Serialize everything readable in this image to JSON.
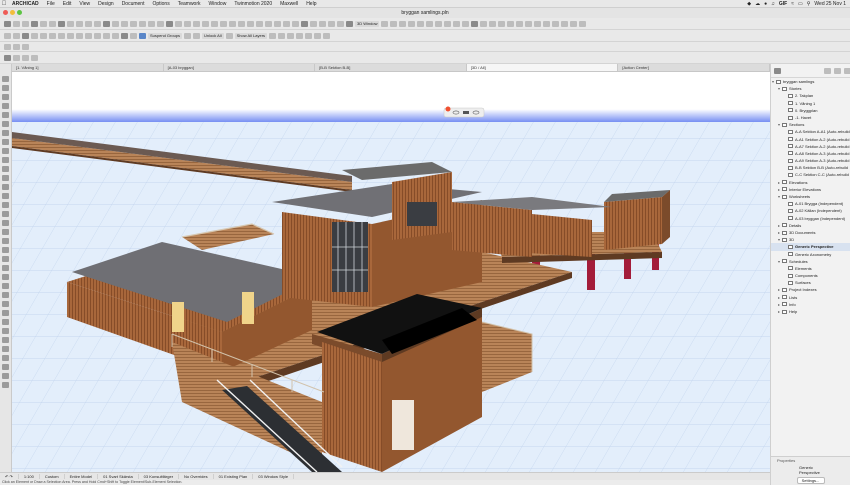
{
  "menubar": {
    "app": "ARCHICAD",
    "items": [
      "File",
      "Edit",
      "View",
      "Design",
      "Document",
      "Options",
      "Teamwork",
      "Window",
      "Twinmotion 2020",
      "Maxwell",
      "Help"
    ],
    "gif": "GIF",
    "clock": "Wed 25 Nov 1"
  },
  "window": {
    "title": "bryggan samlings.pln"
  },
  "toolbar": {
    "window_3d": "3D Window",
    "suspend_groups": "Suspend Groups",
    "unlock_all": "Unlock All",
    "show_all_layers": "Show All Layers"
  },
  "tabs": [
    {
      "label": "[1. Våning 1]"
    },
    {
      "label": "[A-03 bryggan]"
    },
    {
      "label": "[B-B Sektion B-B]"
    },
    {
      "label": "[3D / All]"
    },
    {
      "label": "[Action Center]"
    }
  ],
  "navigator": {
    "items": [
      {
        "label": "bryggan samlings",
        "level": 0,
        "open": true
      },
      {
        "label": "Stories",
        "level": 1,
        "open": true
      },
      {
        "label": "2. Takplan",
        "level": 2
      },
      {
        "label": "1. Våning 1",
        "level": 2
      },
      {
        "label": "0. Bryggplan",
        "level": 2
      },
      {
        "label": "-1. Havet",
        "level": 2
      },
      {
        "label": "Sections",
        "level": 1,
        "open": true
      },
      {
        "label": "A-A Sektion A-A1 (Auto-rebuild",
        "level": 2
      },
      {
        "label": "A-A1 Sektion A-2 (Auto-rebuild",
        "level": 2
      },
      {
        "label": "A-A7 Sektion A-2 (Auto-rebuild",
        "level": 2
      },
      {
        "label": "A-A8 Sektion A-3 (Auto-rebuild",
        "level": 2
      },
      {
        "label": "A-A9 Sektion A-3 (Auto-rebuild",
        "level": 2
      },
      {
        "label": "B-B Sektion B-B (Auto-rebuild",
        "level": 2
      },
      {
        "label": "C-C Sektion C-C (Auto-rebuild",
        "level": 2
      },
      {
        "label": "Elevations",
        "level": 1,
        "open": false
      },
      {
        "label": "Interior Elevations",
        "level": 1,
        "open": false
      },
      {
        "label": "Worksheets",
        "level": 1,
        "open": true
      },
      {
        "label": "A-01 Brygga (Independent)",
        "level": 2
      },
      {
        "label": "A-02 Källan (Independent)",
        "level": 2
      },
      {
        "label": "A-03 bryggan (Independent)",
        "level": 2
      },
      {
        "label": "Details",
        "level": 1,
        "open": false
      },
      {
        "label": "3D Documents",
        "level": 1,
        "open": false
      },
      {
        "label": "3D",
        "level": 1,
        "open": true
      },
      {
        "label": "Generic Perspective",
        "level": 2,
        "selected": true
      },
      {
        "label": "Generic Axonometry",
        "level": 2
      },
      {
        "label": "Schedules",
        "level": 1,
        "open": true
      },
      {
        "label": "Elements",
        "level": 2
      },
      {
        "label": "Components",
        "level": 2
      },
      {
        "label": "Surfaces",
        "level": 2
      },
      {
        "label": "Project Indexes",
        "level": 1,
        "open": false
      },
      {
        "label": "Lists",
        "level": 1,
        "open": false
      },
      {
        "label": "Info",
        "level": 1,
        "open": false
      },
      {
        "label": "Help",
        "level": 1,
        "open": false
      }
    ]
  },
  "properties": {
    "header": "Properties",
    "name": "Generic Perspective",
    "button": "Settings..."
  },
  "statusbar": {
    "zoom": "1:100",
    "view": "Custom",
    "model": "Entire Model",
    "layers": "01 Svart Skärsta",
    "pen": "03 Konsultfärger",
    "override": "No Overrides",
    "renovation": "01 Existing Plan",
    "style": "03 Window Style"
  },
  "hint": "Click an Element or Draw a Selection Area. Press and Hold Cmd+Shift to Toggle Element/Sub-Element Selection.",
  "colors": {
    "sky": "#1e3fe6",
    "ground": "#e3eefb",
    "wood": "#a8673b",
    "pillar": "#a31c3a"
  }
}
